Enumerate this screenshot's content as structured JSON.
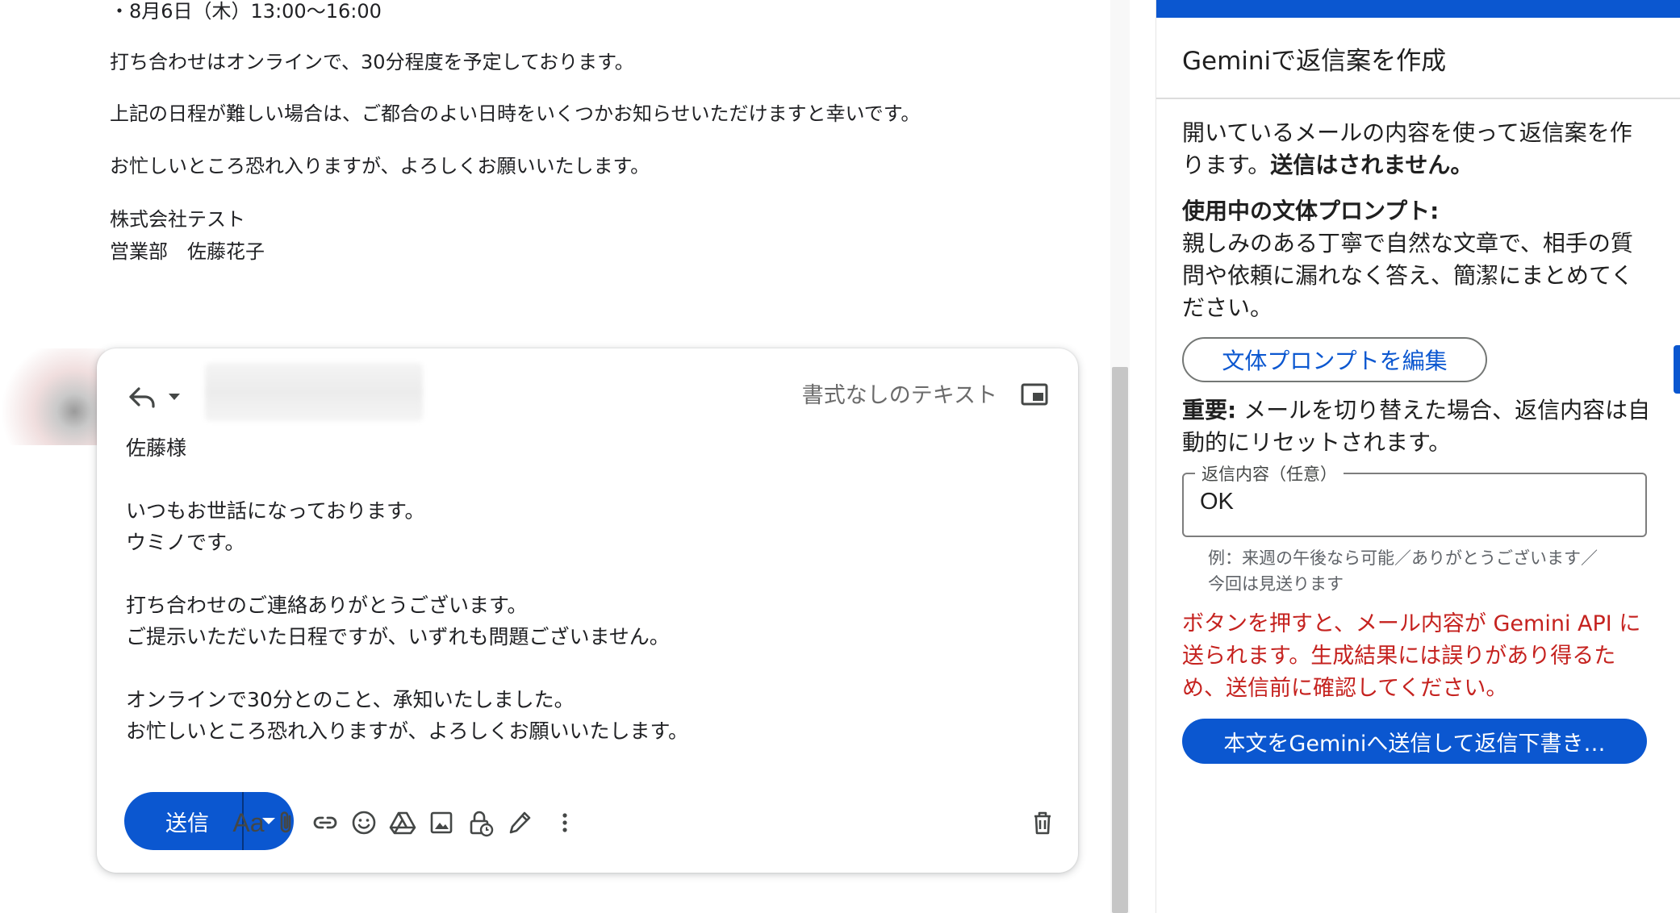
{
  "thread": {
    "lines": [
      "・8月6日（木）13:00〜16:00",
      "打ち合わせはオンラインで、30分程度を予定しております。",
      "上記の日程が難しい場合は、ご都合のよい日時をいくつかお知らせいただけますと幸いです。",
      "お忙しいところ恐れ入りますが、よろしくお願いいたします。",
      "株式会社テスト",
      "営業部　佐藤花子"
    ]
  },
  "compose": {
    "format_label": "書式なしのテキスト",
    "body_lines": [
      "佐藤様",
      "",
      "いつもお世話になっております。",
      "ウミノです。",
      "",
      "打ち合わせのご連絡ありがとうございます。",
      "ご提示いただいた日程ですが、いずれも問題ございません。",
      "",
      "オンラインで30分とのこと、承知いたしました。",
      "お忙しいところ恐れ入りますが、よろしくお願いいたします。"
    ],
    "send_label": "送信",
    "format_button_label": "Aa"
  },
  "panel": {
    "title": "Geminiで返信案を作成",
    "intro_line1": "開いているメールの内容を使って返信案を作",
    "intro_line2_plain": "ります。",
    "intro_line2_bold": "送信はされません。",
    "style_heading": "使用中の文体プロンプト:",
    "style_lines": [
      "親しみのある丁寧で自然な文章で、相手の質",
      "問や依頼に漏れなく答え、簡潔にまとめてく",
      "ださい。"
    ],
    "edit_prompt_label": "文体プロンプトを編集",
    "important_bold": "重要:",
    "important_line1": " メールを切り替えた場合、返信内容は自",
    "important_line2": "動的にリセットされます。",
    "reply_field_label": "返信内容（任意）",
    "reply_field_value": "OK",
    "hint_lines": [
      "例：来週の午後なら可能／ありがとうございます／",
      "今回は見送ります"
    ],
    "warning_lines": [
      "ボタンを押すと、メール内容が Gemini API に",
      "送られます。生成結果には誤りがあり得るた",
      "め、送信前に確認してください。"
    ],
    "generate_label": "本文をGeminiへ送信して返信下書き…"
  },
  "colors": {
    "accent": "#0b57d0",
    "warning": "#c5221f"
  }
}
